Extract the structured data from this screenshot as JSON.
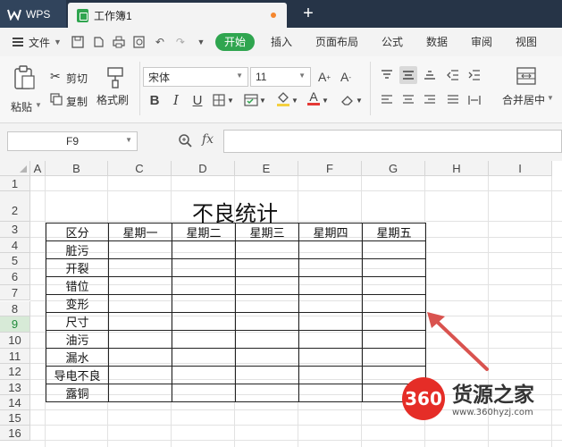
{
  "titlebar": {
    "app_name": "WPS",
    "doc_tab": "工作簿1",
    "new_tab": "+"
  },
  "menubar": {
    "file_label": "文件",
    "items": [
      "开始",
      "插入",
      "页面布局",
      "公式",
      "数据",
      "审阅",
      "视图"
    ],
    "active": "开始"
  },
  "ribbon": {
    "paste": "粘贴",
    "cut": "剪切",
    "copy": "复制",
    "format_painter": "格式刷",
    "font_name": "宋体",
    "font_size": "11",
    "merge_center": "合并居中",
    "bold": "B",
    "italic": "I",
    "underline": "U"
  },
  "formulabar": {
    "name_box": "F9",
    "fx": "fx",
    "value": ""
  },
  "grid": {
    "columns": [
      "A",
      "B",
      "C",
      "D",
      "E",
      "F",
      "G",
      "H",
      "I"
    ],
    "rows": [
      "1",
      "2",
      "3",
      "4",
      "5",
      "6",
      "7",
      "8",
      "9",
      "10",
      "11",
      "12",
      "13",
      "14",
      "15",
      "16"
    ],
    "selected_row": "9"
  },
  "sheet": {
    "title": "不良统计",
    "header": [
      "区分",
      "星期一",
      "星期二",
      "星期三",
      "星期四",
      "星期五"
    ],
    "categories": [
      "脏污",
      "开裂",
      "错位",
      "变形",
      "尺寸",
      "油污",
      "漏水",
      "导电不良",
      "露铜"
    ]
  },
  "watermark": {
    "badge": "360",
    "title": "货源之家",
    "url": "www.360hyzj.com"
  },
  "colors": {
    "accent": "#2fa54f",
    "titlebar": "#263447",
    "arrow": "#d9534f"
  }
}
